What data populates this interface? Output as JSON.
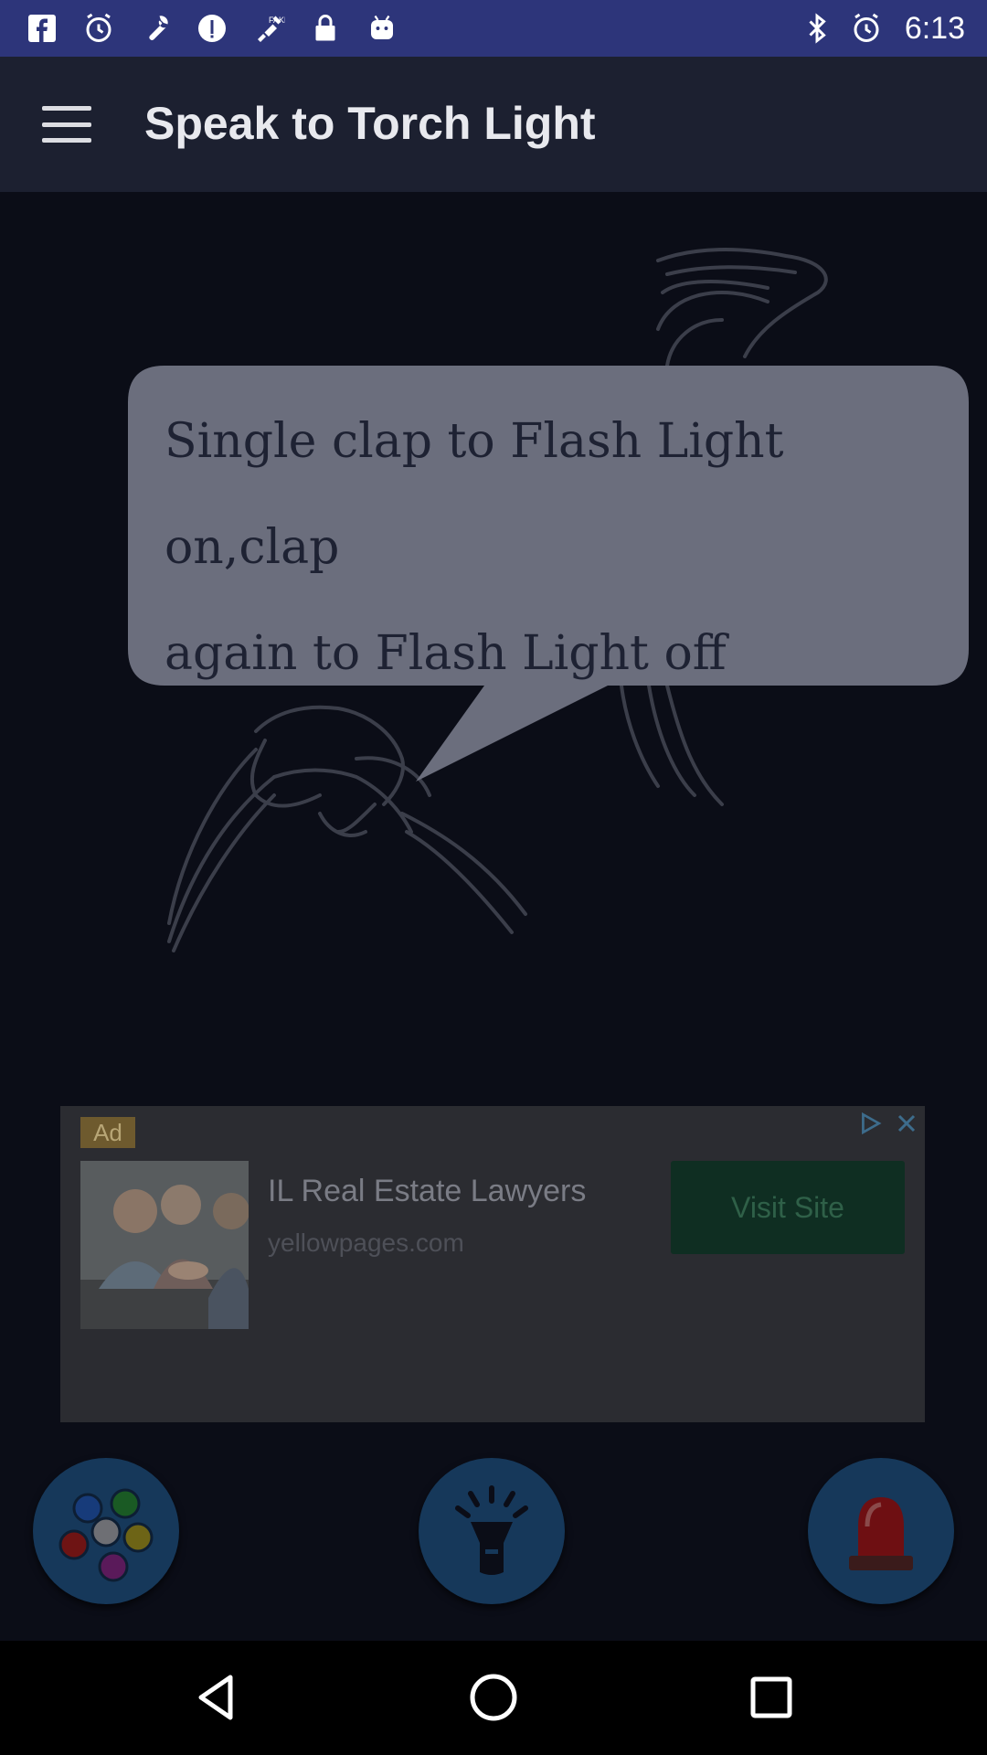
{
  "status_bar": {
    "time": "6:13",
    "left_icons": [
      "facebook-icon",
      "alarm-icon",
      "wrench-icon",
      "info-icon",
      "fake-gps-icon",
      "lock-icon",
      "android-icon"
    ],
    "right_icons": [
      "bluetooth-icon",
      "alarm-icon"
    ]
  },
  "app_bar": {
    "title": "Speak to Torch Light",
    "menu_icon": "hamburger-menu-icon"
  },
  "instruction": {
    "line1": "Single clap to Flash Light on,clap",
    "line2": "again to Flash Light off"
  },
  "ad": {
    "badge": "Ad",
    "headline": "IL Real Estate Lawyers",
    "url": "yellowpages.com",
    "cta": "Visit Site"
  },
  "controls": {
    "colors_icon": "color-palette-icon",
    "torch_icon": "torch-icon",
    "siren_icon": "siren-icon"
  },
  "colors": {
    "status_bar": "#2d357a",
    "app_bar": "#1c2030",
    "background": "#0b0d17",
    "bubble": "#6b6e7d"
  }
}
